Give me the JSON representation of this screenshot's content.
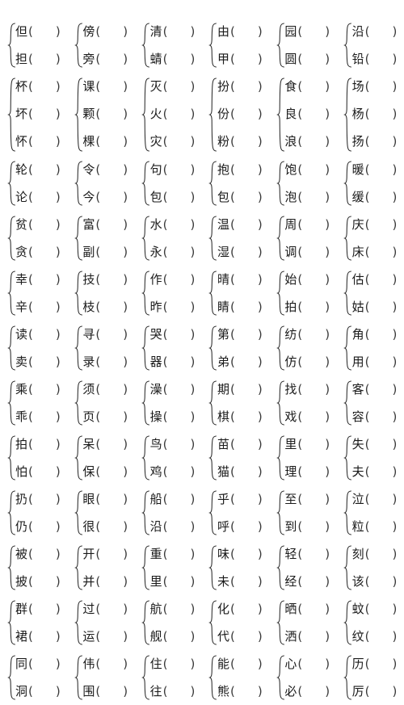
{
  "worksheet": {
    "type": "chinese-character-discrimination-exercise",
    "blank_placeholder": "",
    "paren_open": "(",
    "paren_close": ")",
    "columns": 6,
    "rows": [
      {
        "size": 2,
        "groups": [
          {
            "chars": [
              "但",
              "担"
            ]
          },
          {
            "chars": [
              "傍",
              "旁"
            ]
          },
          {
            "chars": [
              "清",
              "蜻"
            ]
          },
          {
            "chars": [
              "由",
              "甲"
            ]
          },
          {
            "chars": [
              "园",
              "圆"
            ]
          },
          {
            "chars": [
              "沿",
              "铅"
            ]
          }
        ]
      },
      {
        "size": 3,
        "groups": [
          {
            "chars": [
              "杯",
              "坏",
              "怀"
            ]
          },
          {
            "chars": [
              "课",
              "颗",
              "棵"
            ]
          },
          {
            "chars": [
              "灭",
              "火",
              "灾"
            ]
          },
          {
            "chars": [
              "扮",
              "份",
              "粉"
            ]
          },
          {
            "chars": [
              "食",
              "良",
              "浪"
            ]
          },
          {
            "chars": [
              "场",
              "杨",
              "扬"
            ]
          }
        ]
      },
      {
        "size": 2,
        "groups": [
          {
            "chars": [
              "轮",
              "论"
            ]
          },
          {
            "chars": [
              "令",
              "今"
            ]
          },
          {
            "chars": [
              "句",
              "包"
            ]
          },
          {
            "chars": [
              "抱",
              "包"
            ]
          },
          {
            "chars": [
              "饱",
              "泡"
            ]
          },
          {
            "chars": [
              "暖",
              "缓"
            ]
          }
        ]
      },
      {
        "size": 2,
        "groups": [
          {
            "chars": [
              "贫",
              "贪"
            ]
          },
          {
            "chars": [
              "富",
              "副"
            ]
          },
          {
            "chars": [
              "水",
              "永"
            ]
          },
          {
            "chars": [
              "温",
              "湿"
            ]
          },
          {
            "chars": [
              "周",
              "调"
            ]
          },
          {
            "chars": [
              "庆",
              "床"
            ]
          }
        ]
      },
      {
        "size": 2,
        "groups": [
          {
            "chars": [
              "幸",
              "辛"
            ]
          },
          {
            "chars": [
              "技",
              "枝"
            ]
          },
          {
            "chars": [
              "作",
              "昨"
            ]
          },
          {
            "chars": [
              "晴",
              "睛"
            ]
          },
          {
            "chars": [
              "始",
              "拍"
            ]
          },
          {
            "chars": [
              "估",
              "姑"
            ]
          }
        ]
      },
      {
        "size": 2,
        "groups": [
          {
            "chars": [
              "读",
              "卖"
            ]
          },
          {
            "chars": [
              "寻",
              "录"
            ]
          },
          {
            "chars": [
              "哭",
              "器"
            ]
          },
          {
            "chars": [
              "第",
              "弟"
            ]
          },
          {
            "chars": [
              "纺",
              "仿"
            ]
          },
          {
            "chars": [
              "角",
              "用"
            ]
          }
        ]
      },
      {
        "size": 2,
        "groups": [
          {
            "chars": [
              "乘",
              "乖"
            ]
          },
          {
            "chars": [
              "须",
              "页"
            ]
          },
          {
            "chars": [
              "澡",
              "操"
            ]
          },
          {
            "chars": [
              "期",
              "棋"
            ]
          },
          {
            "chars": [
              "找",
              "戏"
            ]
          },
          {
            "chars": [
              "客",
              "容"
            ]
          }
        ]
      },
      {
        "size": 2,
        "groups": [
          {
            "chars": [
              "拍",
              "怕"
            ]
          },
          {
            "chars": [
              "呆",
              "保"
            ]
          },
          {
            "chars": [
              "鸟",
              "鸡"
            ]
          },
          {
            "chars": [
              "苗",
              "猫"
            ]
          },
          {
            "chars": [
              "里",
              "理"
            ]
          },
          {
            "chars": [
              "失",
              "夫"
            ]
          }
        ]
      },
      {
        "size": 2,
        "groups": [
          {
            "chars": [
              "扔",
              "仍"
            ]
          },
          {
            "chars": [
              "眼",
              "很"
            ]
          },
          {
            "chars": [
              "船",
              "沿"
            ]
          },
          {
            "chars": [
              "乎",
              "呼"
            ]
          },
          {
            "chars": [
              "至",
              "到"
            ]
          },
          {
            "chars": [
              "泣",
              "粒"
            ]
          }
        ]
      },
      {
        "size": 2,
        "groups": [
          {
            "chars": [
              "被",
              "披"
            ]
          },
          {
            "chars": [
              "开",
              "并"
            ]
          },
          {
            "chars": [
              "重",
              "里"
            ]
          },
          {
            "chars": [
              "味",
              "未"
            ]
          },
          {
            "chars": [
              "轻",
              "经"
            ]
          },
          {
            "chars": [
              "刻",
              "该"
            ]
          }
        ]
      },
      {
        "size": 2,
        "groups": [
          {
            "chars": [
              "群",
              "裙"
            ]
          },
          {
            "chars": [
              "过",
              "运"
            ]
          },
          {
            "chars": [
              "航",
              "舰"
            ]
          },
          {
            "chars": [
              "化",
              "代"
            ]
          },
          {
            "chars": [
              "晒",
              "洒"
            ]
          },
          {
            "chars": [
              "蚊",
              "纹"
            ]
          }
        ]
      },
      {
        "size": 2,
        "groups": [
          {
            "chars": [
              "同",
              "洞"
            ]
          },
          {
            "chars": [
              "伟",
              "围"
            ]
          },
          {
            "chars": [
              "住",
              "往"
            ]
          },
          {
            "chars": [
              "能",
              "熊"
            ]
          },
          {
            "chars": [
              "心",
              "必"
            ]
          },
          {
            "chars": [
              "历",
              "厉"
            ]
          }
        ]
      }
    ]
  }
}
